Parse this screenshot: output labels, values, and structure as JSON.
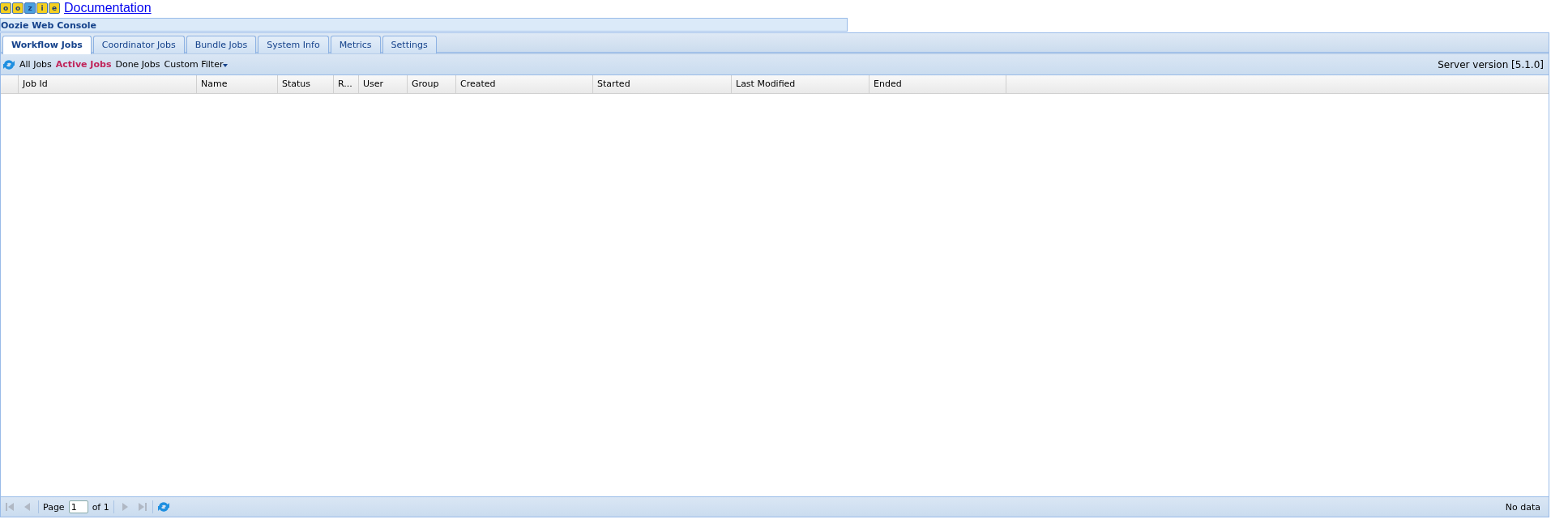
{
  "header": {
    "logo_letters": [
      "o",
      "o",
      "z",
      "i",
      "e"
    ],
    "link": "Documentation"
  },
  "console": {
    "title": "Oozie Web Console"
  },
  "tabs": [
    {
      "label": "Workflow Jobs",
      "selected": true
    },
    {
      "label": "Coordinator Jobs",
      "selected": false
    },
    {
      "label": "Bundle Jobs",
      "selected": false
    },
    {
      "label": "System Info",
      "selected": false
    },
    {
      "label": "Metrics",
      "selected": false
    },
    {
      "label": "Settings",
      "selected": false
    }
  ],
  "toolbar": {
    "filters": [
      {
        "label": "All Jobs",
        "kind": "link",
        "selected": false
      },
      {
        "label": "Active Jobs",
        "kind": "link",
        "selected": true
      },
      {
        "label": "Done Jobs",
        "kind": "link",
        "selected": false
      },
      {
        "label": "Custom Filter",
        "kind": "dropdown",
        "selected": false
      }
    ],
    "server_version": "Server version [5.1.0]"
  },
  "table": {
    "columns": [
      "Job Id",
      "Name",
      "Status",
      "R...",
      "User",
      "Group",
      "Created",
      "Started",
      "Last Modified",
      "Ended"
    ]
  },
  "paging": {
    "page_label": "Page",
    "page_value": "1",
    "of_label": "of 1",
    "first_disabled": true,
    "prev_disabled": true,
    "next_disabled": true,
    "last_disabled": true,
    "status": "No data"
  }
}
